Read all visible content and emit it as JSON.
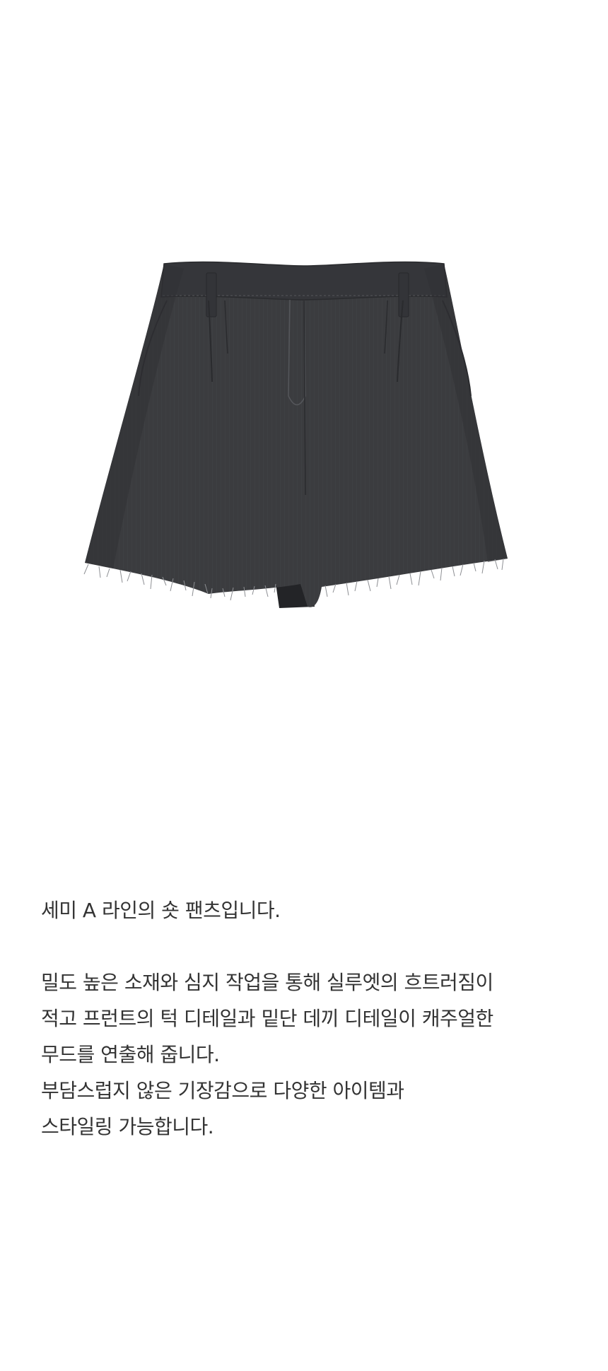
{
  "product": {
    "image_alt": "shorts",
    "colors": {
      "fabric": "#3b3c3f",
      "fabric_shadow": "#2a2b2e",
      "stitch": "#55575b",
      "fringe": "#8d8f93",
      "background": "#ffffff",
      "text": "#333333"
    }
  },
  "description": {
    "intro": "세미 A 라인의 숏 팬츠입니다.",
    "lines": [
      "밀도 높은 소재와 심지 작업을 통해 실루엣의 흐트러짐이",
      "적고 프런트의 턱 디테일과 밑단 데끼 디테일이 캐주얼한",
      "무드를 연출해 줍니다.",
      "부담스럽지 않은 기장감으로 다양한 아이템과",
      "스타일링 가능합니다."
    ]
  }
}
